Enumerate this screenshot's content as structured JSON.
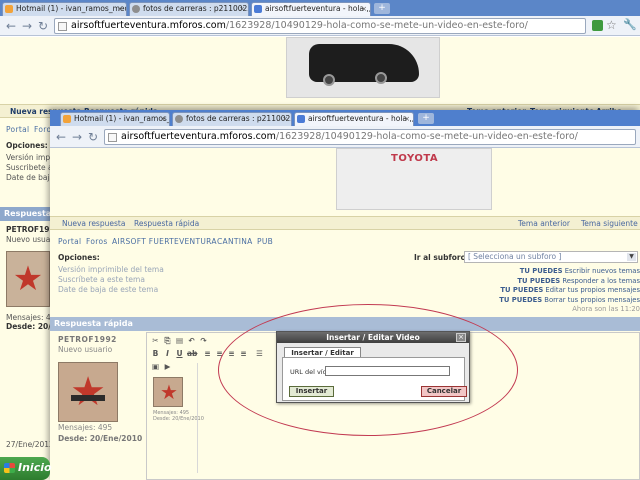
{
  "back_browser": {
    "tabs": [
      {
        "label": "Hotmail (1) - ivan_ramos_med",
        "color": "#f2a33a"
      },
      {
        "label": "fotos de carreras : p2110025",
        "color": "#8e8e8e"
      },
      {
        "label": "airsoftfuerteventura - hola ,,,",
        "color": "#4b7bd6"
      }
    ],
    "new_tab": "+",
    "url_host": "airsoftfuerteventura.mforos.com",
    "url_path": "/1623928/10490129-hola-como-se-mete-un-video-en-este-foro/",
    "nav": {
      "left": [
        "Nueva respuesta",
        "Respuesta rápida"
      ],
      "right": [
        "Tema anterior",
        "Tema siguiente",
        "Arriba"
      ]
    },
    "crumbs": [
      "Portal",
      "Foros"
    ],
    "options_title": "Opciones:",
    "options": [
      "Versión imprimi...",
      "Suscribete a ...",
      "Date de baja d..."
    ],
    "quick_reply_bar": "Respuesta rápi",
    "user": {
      "name": "PETROF199",
      "role": "Nuevo usuario",
      "messages": "Mensajes: 495",
      "since": "Desde: 20/Ene/"
    },
    "post_date": "27/Ene/2012"
  },
  "front_browser": {
    "tabs": [
      {
        "label": "Hotmail (1) - ivan_ramos_medi",
        "color": "#f2a33a"
      },
      {
        "label": "fotos de carreras : p2110025",
        "color": "#8e8e8e"
      },
      {
        "label": "airsoftfuerteventura - hola ,,,",
        "color": "#4b7bd6"
      }
    ],
    "new_tab": "+",
    "url_host": "airsoftfuerteventura.mforos.com",
    "url_path": "/1623928/10490129-hola-como-se-mete-un-video-en-este-foro/",
    "banner_brand": "TOYOTA",
    "nav": {
      "left": [
        "Nueva respuesta",
        "Respuesta rápida"
      ],
      "right": [
        "Tema anterior",
        "Tema siguiente"
      ]
    },
    "crumbs": [
      "Portal",
      "Foros",
      "AIRSOFT FUERTEVENTURA",
      "CANTINA",
      "PUB"
    ],
    "options_title": "Opciones:",
    "options": [
      "Versión imprimible del tema",
      "Suscríbete a este tema",
      "Date de baja de este tema"
    ],
    "subforum_label": "Ir al subforo:",
    "subforum_select": "[ Selecciona un subforo ]",
    "permissions": [
      {
        "strong": "TU PUEDES",
        "text": " Escribir nuevos temas"
      },
      {
        "strong": "TU PUEDES",
        "text": " Responder a los temas"
      },
      {
        "strong": "TU PUEDES",
        "text": " Editar tus propios mensajes"
      },
      {
        "strong": "TU PUEDES",
        "text": " Borrar tus propios mensajes"
      }
    ],
    "time_note": "Ahora son las 11:20",
    "quick_reply_bar": "Respuesta rápida",
    "user": {
      "name": "PETROF1992",
      "role": "Nuevo usuario",
      "messages": "Mensajes: 495",
      "since": "Desde: 20/Ene/2010"
    },
    "editor_mini": {
      "messages": "Mensajes: 495",
      "since": "Desde: 20/Ene/2010"
    }
  },
  "dialog": {
    "title": "Insertar / Editar Video",
    "tab": "Insertar / Editar Video",
    "url_label": "URL del vídeo",
    "url_value": "",
    "insert_button": "Insertar",
    "cancel_button": "Cancelar",
    "close": "×"
  },
  "taskbar": {
    "start_label": "Inicio"
  }
}
